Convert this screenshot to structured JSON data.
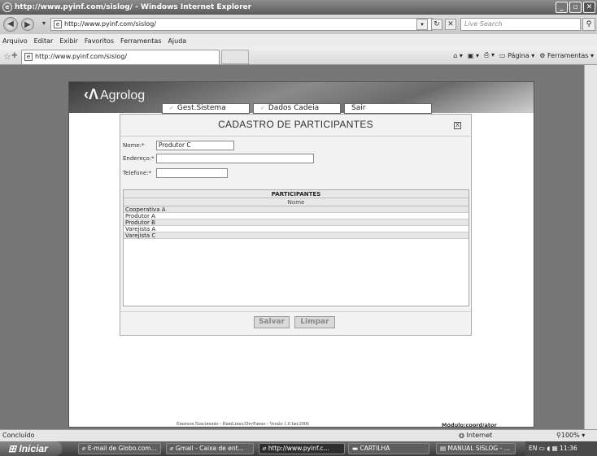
{
  "window": {
    "title": "http://www.pyinf.com/sislog/ - Windows Internet Explorer"
  },
  "addressbar": {
    "url": "http://www.pyinf.com/sislog/",
    "search_placeholder": "Live Search"
  },
  "menubar": {
    "items": [
      "Arquivo",
      "Editar",
      "Exibir",
      "Favoritos",
      "Ferramentas",
      "Ajuda"
    ]
  },
  "tabs": {
    "active_tab": "http://www.pyinf.com/sislog/",
    "page_label": "Página",
    "tools_label": "Ferramentas"
  },
  "app": {
    "logo": "Agrolog",
    "nav": [
      "Gest.Sistema",
      "Dados Cadeia",
      "Sair"
    ]
  },
  "dialog": {
    "title": "CADASTRO DE PARTICIPANTES",
    "close_glyph": "X",
    "fields": {
      "nome_label": "Nome:*",
      "nome_value": "Produtor C",
      "endereco_label": "Endereço:*",
      "endereco_value": "",
      "telefone_label": "Telefone:*",
      "telefone_value": ""
    },
    "grid": {
      "title": "PARTICIPANTES",
      "column": "Nome",
      "rows": [
        "Cooperativa A",
        "Produtor A",
        "Produtor B",
        "Varejista A",
        "Varejista C"
      ]
    },
    "buttons": {
      "save": "Salvar",
      "clear": "Limpar"
    }
  },
  "footer": {
    "credits": "Emerson Nascimento - HamLinux/DevPamer - Versão 1.0 Jan/2006",
    "module": "Módulo:coord/ator"
  },
  "statusbar": {
    "status": "Concluído",
    "zone": "Internet",
    "zoom": "100%"
  },
  "taskbar": {
    "start": "Iniciar",
    "tasks": [
      "E-mail de Globo.com...",
      "Gmail - Caixa de ent...",
      "http://www.pyinf.c...",
      "CARTILHA",
      "MANUAL SISLOG - ..."
    ],
    "lang": "EN",
    "clock": "11:36"
  }
}
